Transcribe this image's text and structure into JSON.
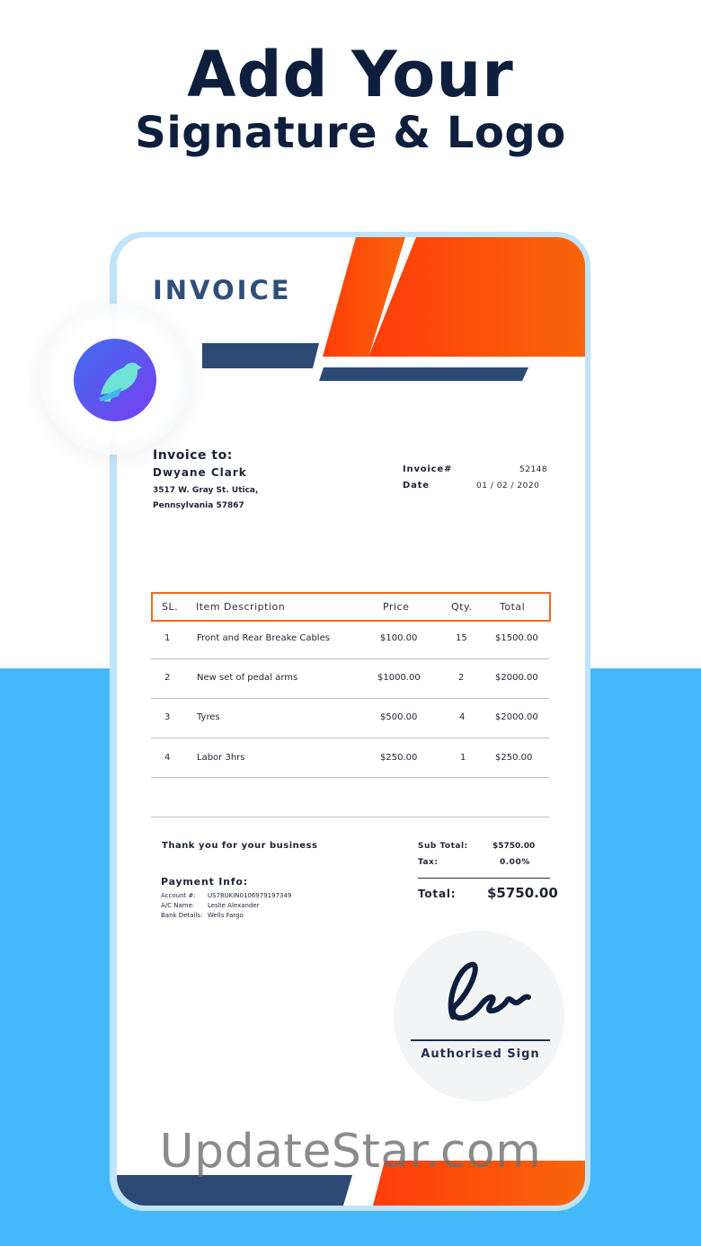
{
  "hero": {
    "line1": "Add Your",
    "line2": "Signature & Logo"
  },
  "invoice": {
    "title": "INVOICE",
    "bill_to_label": "Invoice to:",
    "client_name": "Dwyane Clark",
    "address_line1": "3517 W. Gray St. Utica,",
    "address_line2": "Pennsylvania 57867",
    "number_label": "Invoice#",
    "number_value": "52148",
    "date_label": "Date",
    "date_value": "01 / 02 / 2020",
    "columns": [
      "SL.",
      "Item Description",
      "Price",
      "Qty.",
      "Total"
    ],
    "rows": [
      {
        "sl": "1",
        "desc": "Front and Rear Breake Cables",
        "price": "$100.00",
        "qty": "15",
        "total": "$1500.00"
      },
      {
        "sl": "2",
        "desc": "New set of pedal arms",
        "price": "$1000.00",
        "qty": "2",
        "total": "$2000.00"
      },
      {
        "sl": "3",
        "desc": "Tyres",
        "price": "$500.00",
        "qty": "4",
        "total": "$2000.00"
      },
      {
        "sl": "4",
        "desc": "Labor 3hrs",
        "price": "$250.00",
        "qty": "1",
        "total": "$250.00"
      }
    ],
    "thanks": "Thank you for your business",
    "payment_title": "Payment Info:",
    "account_label": "Account #:",
    "account_value": "US78UKIN0106979197349",
    "acname_label": "A/C Name:",
    "acname_value": "Leslie Alexander",
    "bank_label": "Bank Details:",
    "bank_value": "Wells Fargo",
    "subtotal_label": "Sub Total:",
    "subtotal_value": "$5750.00",
    "tax_label": "Tax:",
    "tax_value": "0.00%",
    "total_label": "Total:",
    "total_value": "$5750.00",
    "sign_label": "Authorised Sign"
  },
  "watermark": "UpdateStar.com",
  "colors": {
    "navy": "#2c4a74",
    "orange_start": "#ff3d0a",
    "orange_end": "#f8650a",
    "sky": "#45b8fb",
    "header_outline": "#f26a1f"
  },
  "icons": {
    "logo": "bird-logo-icon",
    "signature": "signature-scribble"
  }
}
